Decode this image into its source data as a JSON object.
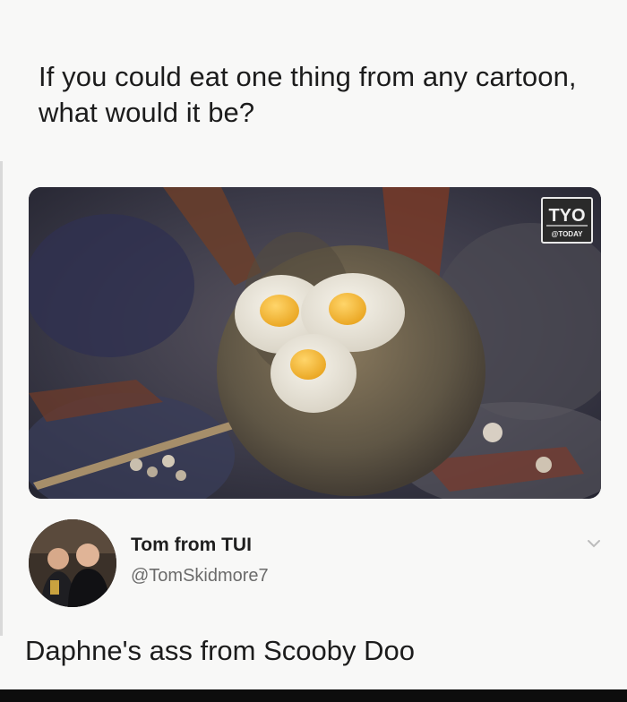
{
  "post": {
    "question": "If you could eat one thing from any cartoon, what would it be?",
    "image_watermark": {
      "top": "TYO",
      "bottom": "@TODAY"
    }
  },
  "reply": {
    "author_name": "Tom from TUI",
    "author_handle": "@TomSkidmore7",
    "text": "Daphne's ass from Scooby Doo"
  },
  "icons": {
    "chevron": "chevron-down-icon",
    "avatar": "avatar"
  }
}
